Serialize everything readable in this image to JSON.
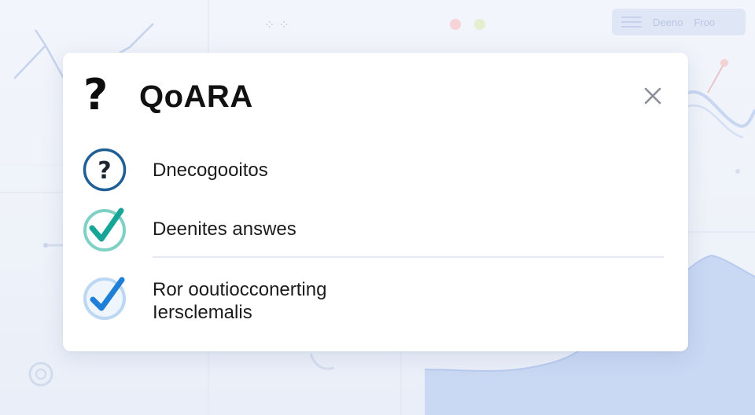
{
  "background": {
    "toolbar_text": "Deeno",
    "toolbar_text_2": "Froo"
  },
  "dialog": {
    "brand_mark": "?",
    "title": "QoARA",
    "close_icon": "close-icon",
    "items": [
      {
        "icon": "question-circle-icon",
        "label": "Dnecogooitos"
      },
      {
        "icon": "check-circle-icon",
        "label": "Deenites answes"
      },
      {
        "icon": "check-circle-icon",
        "label": "Ror ooutiocconerting",
        "sublabel": "Iersclemalis"
      }
    ]
  },
  "colors": {
    "question_ring": "#1f5f96",
    "check_teal": "#1aa79a",
    "check_blue": "#1f7fd6",
    "accent_bg": "#c9d8f3"
  }
}
